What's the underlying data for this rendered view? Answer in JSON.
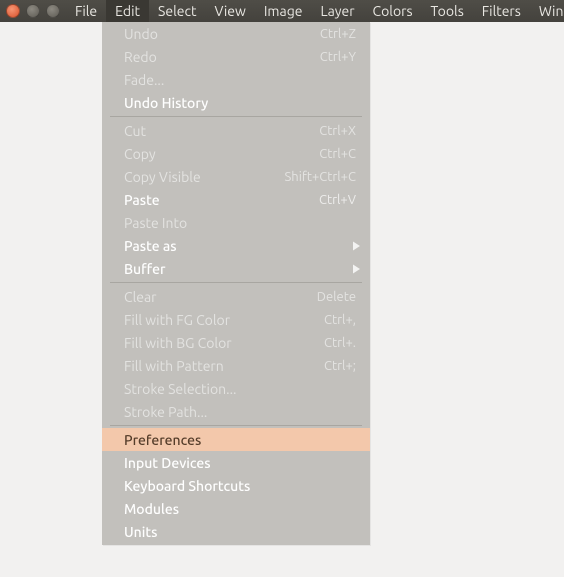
{
  "menubar": {
    "items": [
      {
        "label": "File"
      },
      {
        "label": "Edit",
        "open": true
      },
      {
        "label": "Select"
      },
      {
        "label": "View"
      },
      {
        "label": "Image"
      },
      {
        "label": "Layer"
      },
      {
        "label": "Colors"
      },
      {
        "label": "Tools"
      },
      {
        "label": "Filters"
      },
      {
        "label": "Windows"
      }
    ]
  },
  "editMenu": {
    "groups": [
      [
        {
          "label": "Undo",
          "accel": "Ctrl+Z",
          "enabled": false
        },
        {
          "label": "Redo",
          "accel": "Ctrl+Y",
          "enabled": false
        },
        {
          "label": "Fade...",
          "enabled": false
        },
        {
          "label": "Undo History",
          "enabled": true
        }
      ],
      [
        {
          "label": "Cut",
          "accel": "Ctrl+X",
          "enabled": false
        },
        {
          "label": "Copy",
          "accel": "Ctrl+C",
          "enabled": false
        },
        {
          "label": "Copy Visible",
          "accel": "Shift+Ctrl+C",
          "enabled": false
        },
        {
          "label": "Paste",
          "accel": "Ctrl+V",
          "enabled": true
        },
        {
          "label": "Paste Into",
          "enabled": false
        },
        {
          "label": "Paste as",
          "enabled": true,
          "submenu": true
        },
        {
          "label": "Buffer",
          "enabled": true,
          "submenu": true
        }
      ],
      [
        {
          "label": "Clear",
          "accel": "Delete",
          "enabled": false
        },
        {
          "label": "Fill with FG Color",
          "accel": "Ctrl+,",
          "enabled": false
        },
        {
          "label": "Fill with BG Color",
          "accel": "Ctrl+.",
          "enabled": false
        },
        {
          "label": "Fill with Pattern",
          "accel": "Ctrl+;",
          "enabled": false
        },
        {
          "label": "Stroke Selection...",
          "enabled": false
        },
        {
          "label": "Stroke Path...",
          "enabled": false
        }
      ],
      [
        {
          "label": "Preferences",
          "enabled": true,
          "highlight": true
        },
        {
          "label": "Input Devices",
          "enabled": true
        },
        {
          "label": "Keyboard Shortcuts",
          "enabled": true
        },
        {
          "label": "Modules",
          "enabled": true
        },
        {
          "label": "Units",
          "enabled": true
        }
      ]
    ]
  }
}
